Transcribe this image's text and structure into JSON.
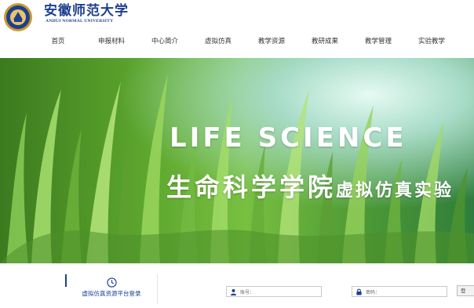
{
  "header": {
    "logo": {
      "name_cn": "安徽师范大学",
      "name_en": "ANHUI NORMAL UNIVERSITY"
    },
    "nav": [
      {
        "label": "首页"
      },
      {
        "label": "申报材料"
      },
      {
        "label": "中心简介"
      },
      {
        "label": "虚拟仿真"
      },
      {
        "label": "教学资源"
      },
      {
        "label": "教研成果"
      },
      {
        "label": "教学管理"
      },
      {
        "label": "实验教学"
      }
    ]
  },
  "banner": {
    "headline_en": "LIFE SCIENCE",
    "headline_cn": "生命科学学院",
    "headline_cn_suffix": "虚拟仿真实验"
  },
  "footer": {
    "login_entry_label": "虚拟仿真资源平台登录",
    "username_label": "账号：",
    "password_label": "密码：",
    "login_button": "登"
  },
  "colors": {
    "brand": "#1d3f8e",
    "banner_green": "#5aa32c"
  },
  "icons": [
    "university-emblem-icon",
    "clock-icon",
    "user-icon",
    "lock-icon"
  ]
}
